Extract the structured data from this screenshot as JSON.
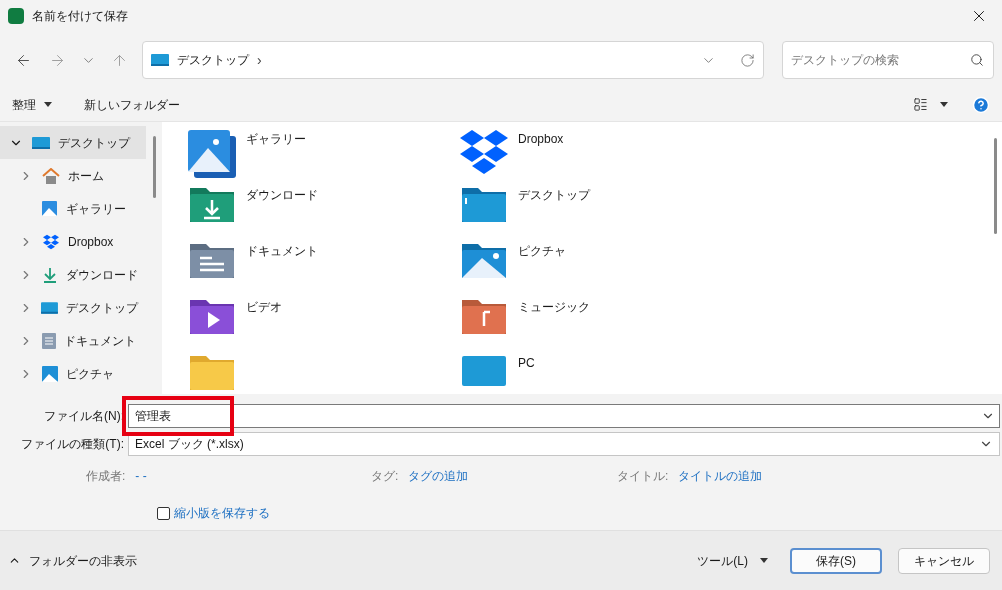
{
  "window": {
    "title": "名前を付けて保存"
  },
  "address": {
    "path": "デスクトップ",
    "separator": "›"
  },
  "search": {
    "placeholder": "デスクトップの検索"
  },
  "toolbar": {
    "organize": "整理",
    "new_folder": "新しいフォルダー"
  },
  "sidebar": {
    "items": [
      {
        "label": "デスクトップ",
        "kind": "desktop",
        "selected": true,
        "expanded": true
      },
      {
        "label": "ホーム",
        "kind": "home",
        "selected": false,
        "expanded": false
      },
      {
        "label": "ギャラリー",
        "kind": "gallery",
        "selected": false
      },
      {
        "label": "Dropbox",
        "kind": "dropbox",
        "selected": false,
        "expanded": false
      },
      {
        "label": "ダウンロード",
        "kind": "download",
        "selected": false,
        "expanded": false
      },
      {
        "label": "デスクトップ",
        "kind": "desktop",
        "selected": false,
        "expanded": false
      },
      {
        "label": "ドキュメント",
        "kind": "documents",
        "selected": false,
        "expanded": false
      },
      {
        "label": "ピクチャ",
        "kind": "pictures",
        "selected": false,
        "expanded": false
      }
    ]
  },
  "content": {
    "items": [
      {
        "label": "ギャラリー",
        "kind": "gallery"
      },
      {
        "label": "Dropbox",
        "kind": "dropbox"
      },
      {
        "label": "ダウンロード",
        "kind": "download"
      },
      {
        "label": "デスクトップ",
        "kind": "desktop"
      },
      {
        "label": "ドキュメント",
        "kind": "documents"
      },
      {
        "label": "ピクチャ",
        "kind": "pictures"
      },
      {
        "label": "ビデオ",
        "kind": "videos"
      },
      {
        "label": "ミュージック",
        "kind": "music"
      },
      {
        "kind": "folder"
      },
      {
        "label": "PC",
        "kind": "pc"
      }
    ]
  },
  "form": {
    "filename": {
      "label": "ファイル名(N):",
      "value": "管理表",
      "highlighted": true
    },
    "filetype": {
      "label": "ファイルの種類(T):",
      "value": "Excel ブック (*.xlsx)"
    },
    "meta": [
      {
        "label": "作成者:",
        "value": "- -"
      },
      {
        "label": "タグ:",
        "value": "タグの追加"
      },
      {
        "label": "タイトル:",
        "value": "タイトルの追加"
      }
    ],
    "thumbnail": {
      "label": "縮小版を保存する",
      "checked": false
    }
  },
  "footer": {
    "hide_folders": "フォルダーの非表示",
    "tools": "ツール(L)",
    "save": "保存(S)",
    "cancel": "キャンセル"
  }
}
